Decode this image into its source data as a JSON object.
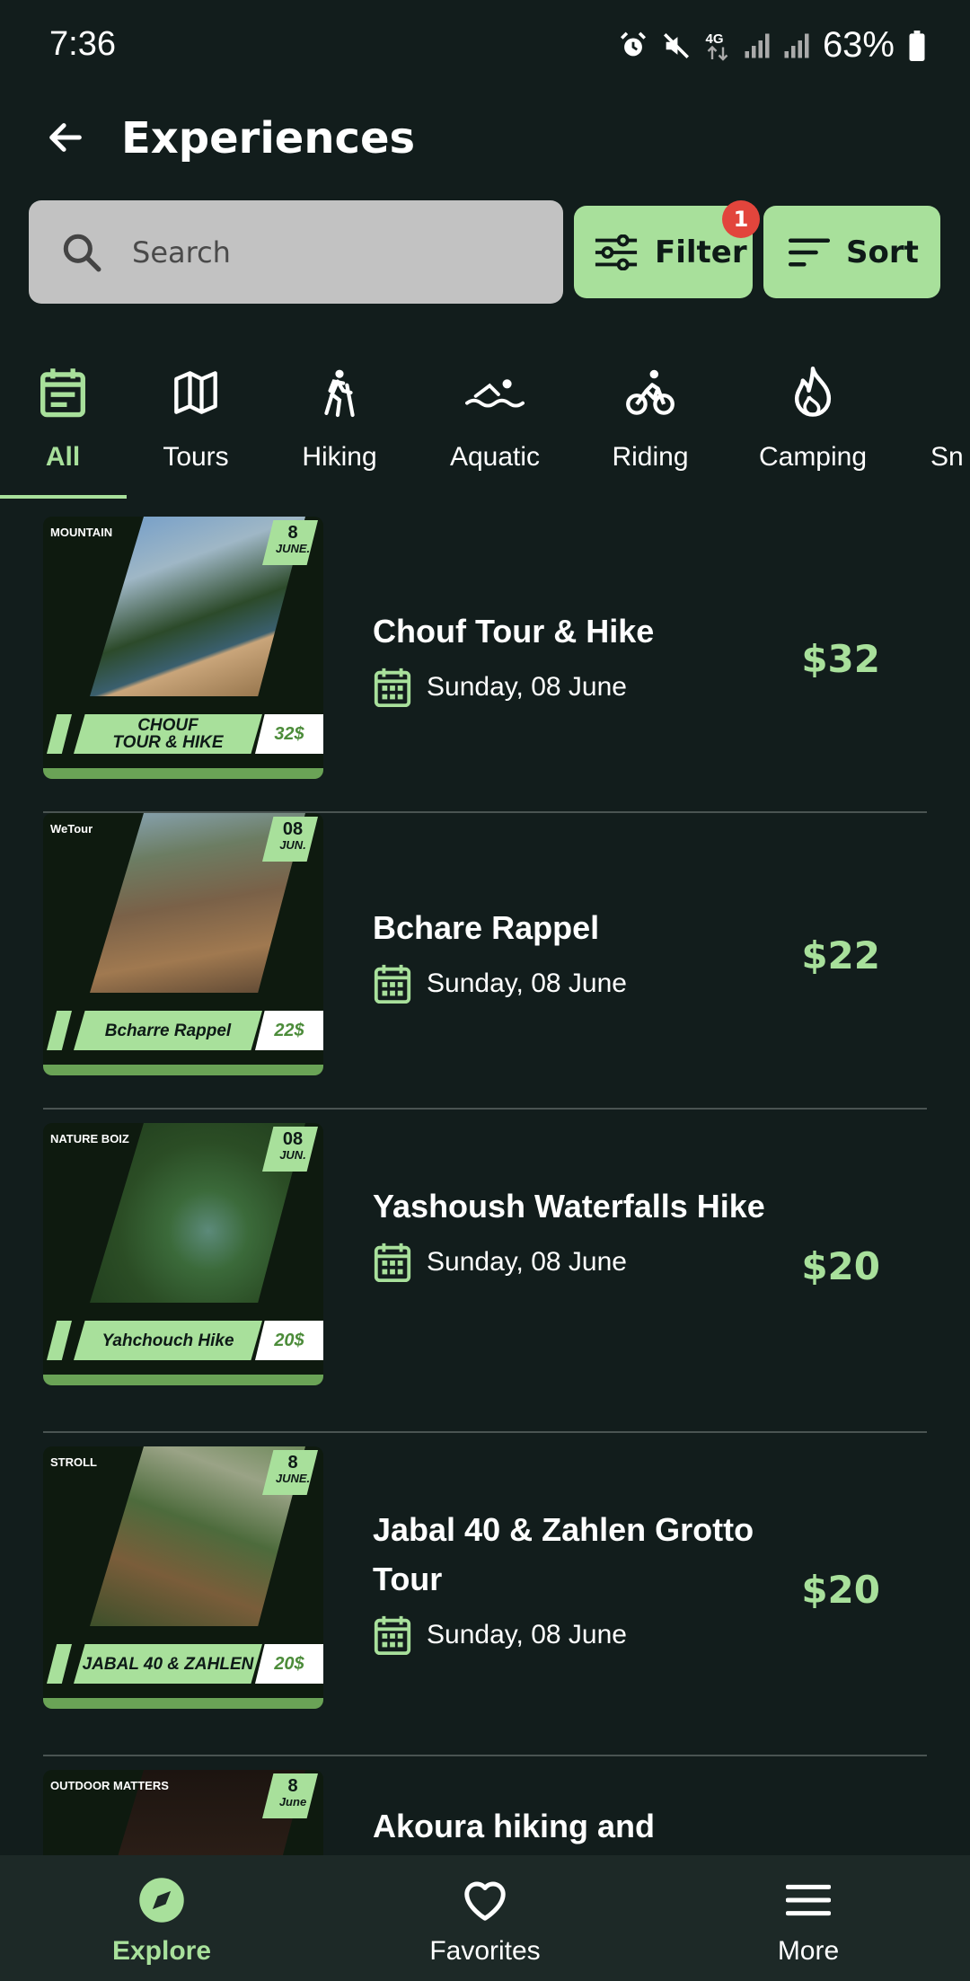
{
  "status_bar": {
    "time": "7:36",
    "battery": "63%",
    "network": "4G"
  },
  "header": {
    "title": "Experiences"
  },
  "search": {
    "placeholder": "Search"
  },
  "toolbar": {
    "filter_label": "Filter",
    "filter_badge": "1",
    "sort_label": "Sort"
  },
  "categories": [
    {
      "label": "All",
      "icon": "calendar-list-icon",
      "active": true
    },
    {
      "label": "Tours",
      "icon": "map-icon"
    },
    {
      "label": "Hiking",
      "icon": "hiker-icon"
    },
    {
      "label": "Aquatic",
      "icon": "swimmer-icon"
    },
    {
      "label": "Riding",
      "icon": "cyclist-icon"
    },
    {
      "label": "Camping",
      "icon": "flame-icon"
    },
    {
      "label": "Sn",
      "icon": ""
    }
  ],
  "experiences": [
    {
      "title": "Chouf Tour &  Hike",
      "date": "Sunday, 08 June",
      "price": "$32",
      "thumb": {
        "day": "8",
        "month": "JUNE.",
        "logo": "MOUNTAIN",
        "banner": "CHOUF\nTOUR & HIKE",
        "price": "32$"
      }
    },
    {
      "title": "Bchare Rappel",
      "date": "Sunday, 08 June",
      "price": "$22",
      "thumb": {
        "day": "08",
        "month": "JUN.",
        "logo": "WeTour",
        "banner": "Bcharre Rappel",
        "price": "22$"
      }
    },
    {
      "title": "Yashoush Waterfalls Hike",
      "date": "Sunday, 08 June",
      "price": "$20",
      "thumb": {
        "day": "08",
        "month": "JUN.",
        "logo": "NATURE BOIZ",
        "banner": "Yahchouch Hike",
        "price": "20$"
      }
    },
    {
      "title": "Jabal 40 & Zahlen Grotto Tour",
      "date": "Sunday, 08 June",
      "price": "$20",
      "thumb": {
        "day": "8",
        "month": "JUNE.",
        "logo": "STROLL",
        "banner": "JABAL 40 & ZAHLEN",
        "price": "20$"
      }
    },
    {
      "title": "Akoura hiking and",
      "date": "",
      "price": "",
      "thumb": {
        "day": "8",
        "month": "June",
        "logo": "OUTDOOR MATTERS",
        "banner": "",
        "price": ""
      }
    }
  ],
  "bottom_nav": [
    {
      "label": "Explore",
      "icon": "compass-icon",
      "active": true
    },
    {
      "label": "Favorites",
      "icon": "heart-icon"
    },
    {
      "label": "More",
      "icon": "menu-icon"
    }
  ],
  "colors": {
    "background": "#121d1c",
    "accent": "#a8e09b",
    "nav_background": "#1d2927",
    "badge": "#e2453c",
    "search_background": "#c2c2c2"
  }
}
